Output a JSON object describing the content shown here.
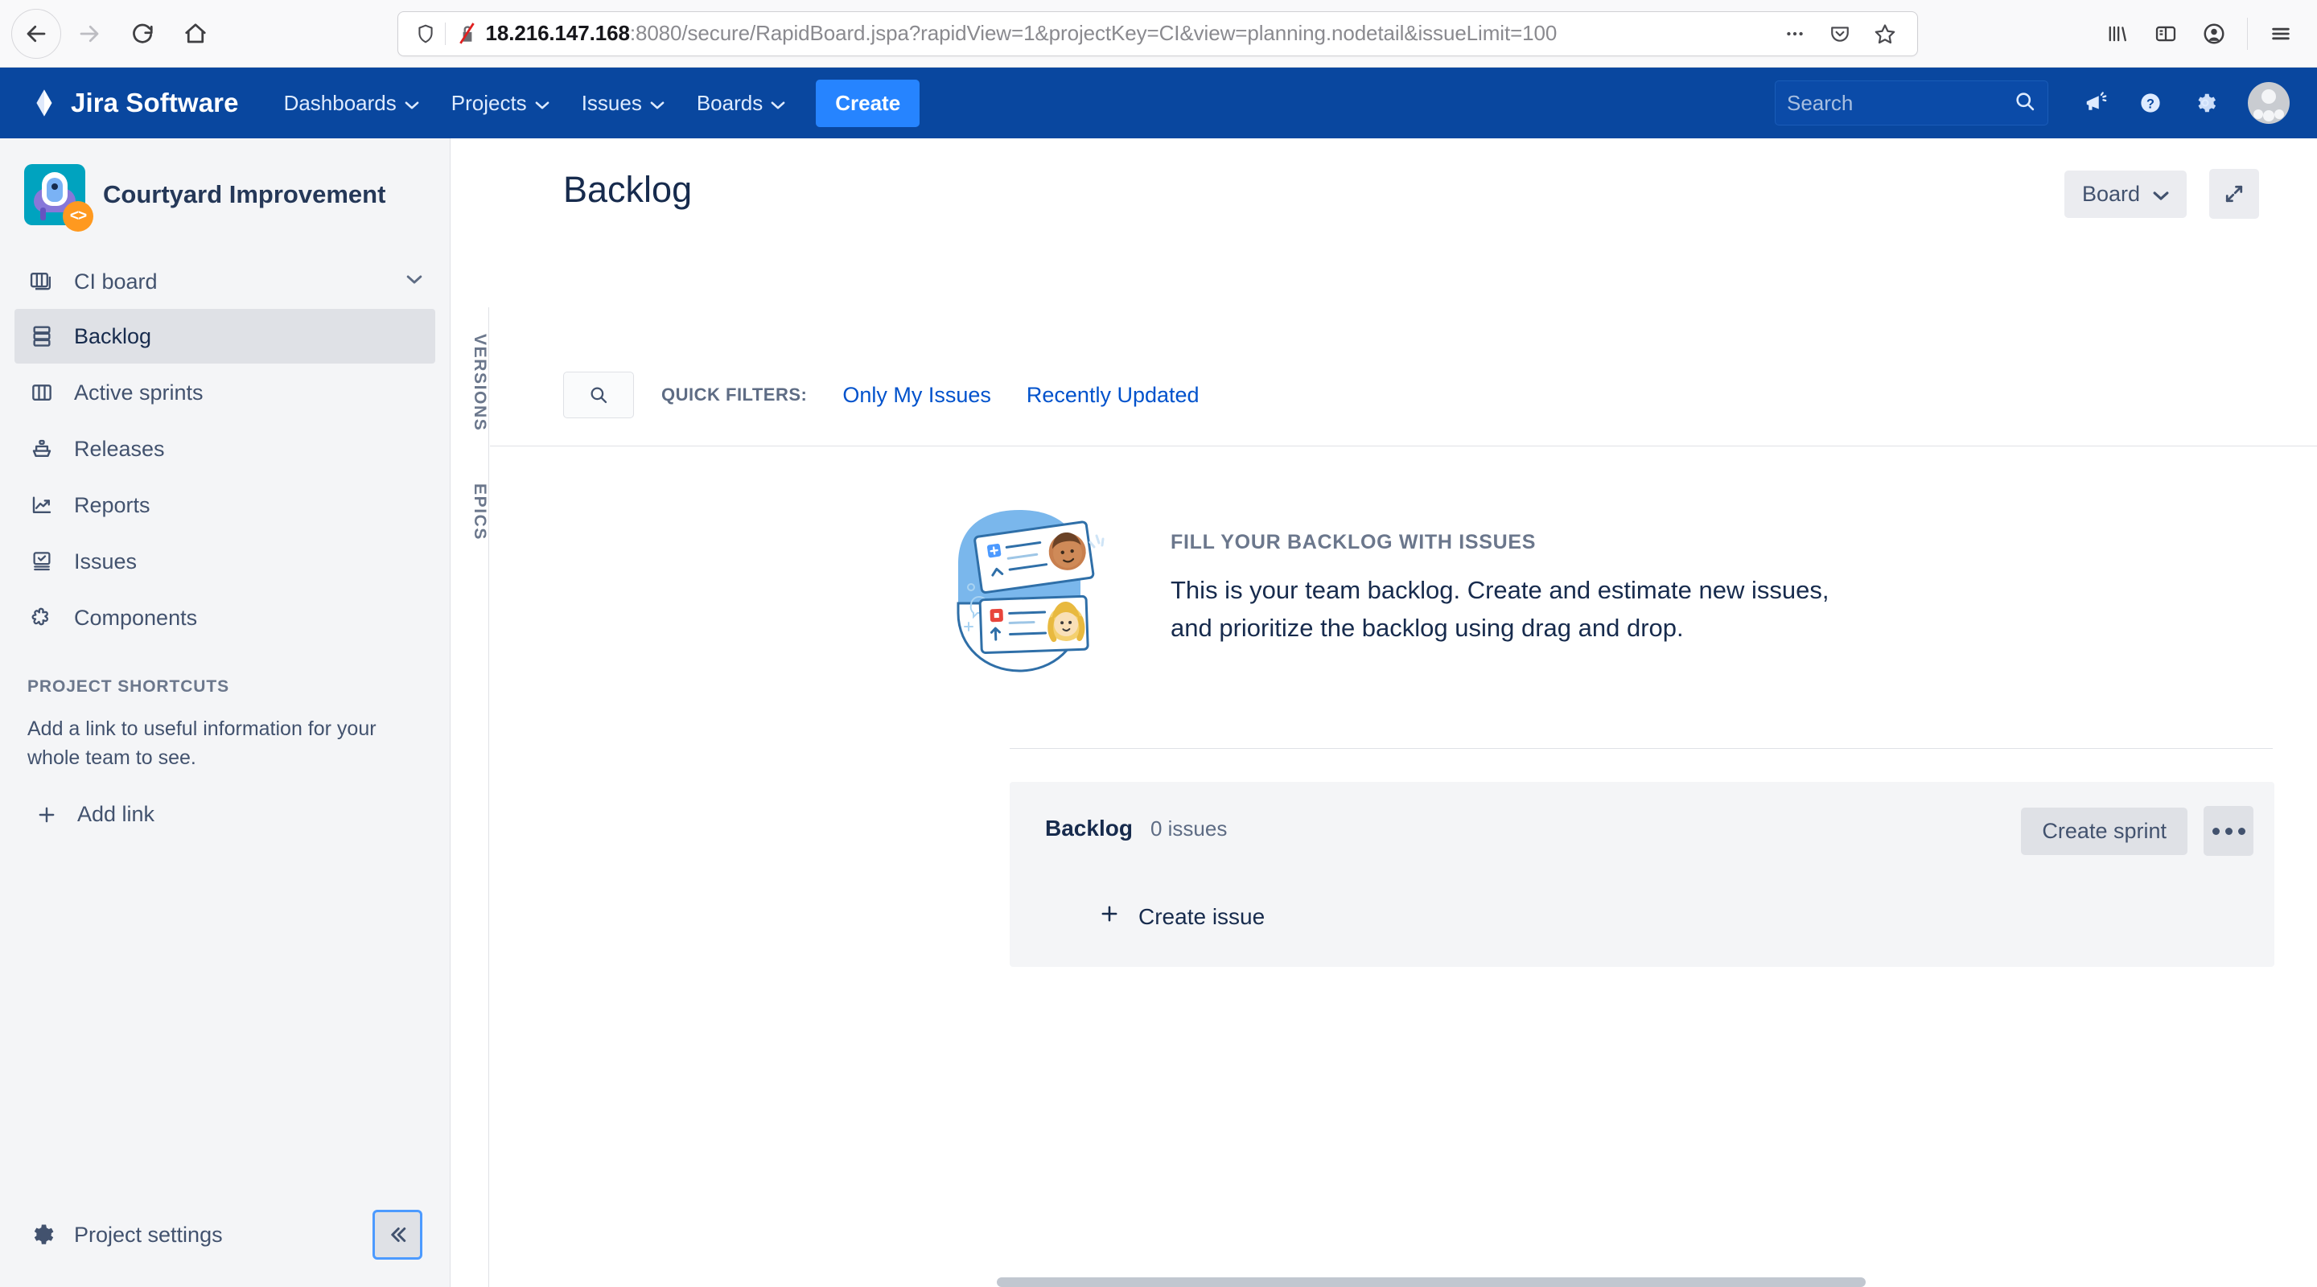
{
  "browser": {
    "back_icon": "back-arrow-icon",
    "forward_icon": "forward-arrow-icon",
    "reload_icon": "reload-icon",
    "home_icon": "home-icon",
    "url_host": "18.216.147.168",
    "url_rest": ":8080/secure/RapidBoard.jspa?rapidView=1&projectKey=CI&view=planning.nodetail&issueLimit=100",
    "shield_icon": "tracking-shield-icon",
    "insecure_icon": "broken-lock-icon",
    "more_icon": "page-actions-ellipsis-icon",
    "pocket_icon": "save-to-pocket-icon",
    "bookmark_icon": "bookmark-star-icon",
    "library_icon": "library-icon",
    "sidebar_icon": "sidebar-toggle-icon",
    "account_icon": "account-icon",
    "menu_icon": "hamburger-menu-icon"
  },
  "topnav": {
    "logo_text": "Jira Software",
    "logo_icon": "jira-diamond-logo-icon",
    "items": [
      {
        "label": "Dashboards",
        "caret": "⌄"
      },
      {
        "label": "Projects",
        "caret": "⌄"
      },
      {
        "label": "Issues",
        "caret": "⌄"
      },
      {
        "label": "Boards",
        "caret": "⌄"
      }
    ],
    "create_label": "Create",
    "search_placeholder": "Search",
    "search_icon": "search-icon",
    "announce_icon": "megaphone-icon",
    "help_icon": "help-circle-icon",
    "settings_icon": "gear-icon",
    "avatar_icon": "user-avatar"
  },
  "sidebar": {
    "project_name": "Courtyard Improvement",
    "project_avatar_icon": "project-avatar-icon",
    "project_badge_icon": "code-badge-icon",
    "board": {
      "label": "CI board",
      "icon": "board-columns-icon",
      "chevron": "⌄"
    },
    "items": [
      {
        "label": "Backlog",
        "icon": "backlog-stack-icon",
        "active": true
      },
      {
        "label": "Active sprints",
        "icon": "columns-icon",
        "active": false
      },
      {
        "label": "Releases",
        "icon": "ship-icon",
        "active": false
      },
      {
        "label": "Reports",
        "icon": "chart-trend-icon",
        "active": false
      },
      {
        "label": "Issues",
        "icon": "issues-check-icon",
        "active": false
      },
      {
        "label": "Components",
        "icon": "puzzle-piece-icon",
        "active": false
      }
    ],
    "shortcuts_title": "PROJECT SHORTCUTS",
    "shortcuts_desc": "Add a link to useful information for your whole team to see.",
    "add_link_label": "Add link",
    "add_link_icon": "plus-icon",
    "project_settings_label": "Project settings",
    "project_settings_icon": "gear-icon",
    "collapse_icon": "double-chevron-left-icon"
  },
  "vertical_tabs": [
    {
      "label": "VERSIONS"
    },
    {
      "label": "EPICS"
    }
  ],
  "main": {
    "title": "Backlog",
    "board_select_label": "Board",
    "board_select_caret": "⌄",
    "expand_icon": "expand-diagonal-icon",
    "filter_search_icon": "search-icon",
    "quick_filters_label": "QUICK FILTERS:",
    "quick_filters": [
      {
        "label": "Only My Issues"
      },
      {
        "label": "Recently Updated"
      }
    ],
    "empty_state": {
      "illustration_icon": "backlog-empty-illustration",
      "eyebrow": "FILL YOUR BACKLOG WITH ISSUES",
      "line1": "This is your team backlog. Create and estimate new issues,",
      "line2": "and prioritize the backlog using drag and drop."
    },
    "backlog_section": {
      "name": "Backlog",
      "count": "0 issues",
      "create_sprint_label": "Create sprint",
      "more_icon": "ellipsis-icon",
      "create_issue_label": "Create issue",
      "create_issue_icon": "plus-icon"
    }
  },
  "colors": {
    "jira_blue": "#09479f",
    "create_blue": "#2684ff",
    "link_blue": "#0052cc",
    "sidebar_bg": "#f4f5f7",
    "text_dark": "#172b4d",
    "text_muted": "#5e6c84",
    "focus_ring": "#4c9aff",
    "project_avatar_bg": "#00a3bf",
    "badge_orange": "#ff991f"
  }
}
